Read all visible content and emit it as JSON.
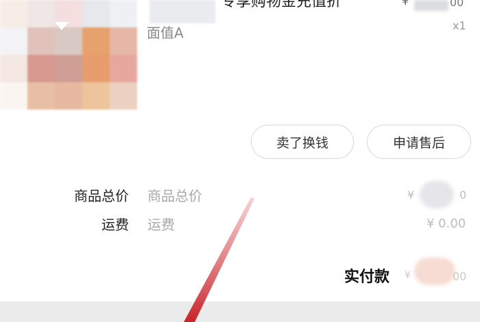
{
  "product": {
    "title": "专享购物金充值折",
    "variant": "面值A",
    "price_symbol": "¥",
    "price_tail": "00",
    "quantity": "x1",
    "image_colors": [
      "#f7ece6",
      "#efe6e6",
      "#f4dede",
      "#e6e8ec",
      "#eef0f3",
      "#f3f3f5",
      "#e1c2bb",
      "#d9c9c4",
      "#e7a16c",
      "#e6b7a6",
      "#f5e7e2",
      "#d79a90",
      "#cf9f95",
      "#e79d6e",
      "#e7a79f",
      "#fbf5f2",
      "#e8bfa4",
      "#e7b9a0",
      "#eec49c",
      "#ecd0c2"
    ]
  },
  "actions": {
    "sell_label": "卖了换钱",
    "after_sales_label": "申请售后"
  },
  "summary": {
    "total_label": "商品总价",
    "total_value": "商品总价",
    "total_amount_symbol": "¥",
    "total_amount_tail": "0",
    "shipping_label": "运费",
    "shipping_value": "运费",
    "shipping_amount": "¥ 0.00",
    "paid_label": "实付款",
    "paid_symbol": "¥",
    "paid_tail": "00"
  },
  "colors": {
    "annotation_arrow": "#c8252b",
    "button_border": "#d8d8d8",
    "footer": "#ecebec"
  }
}
